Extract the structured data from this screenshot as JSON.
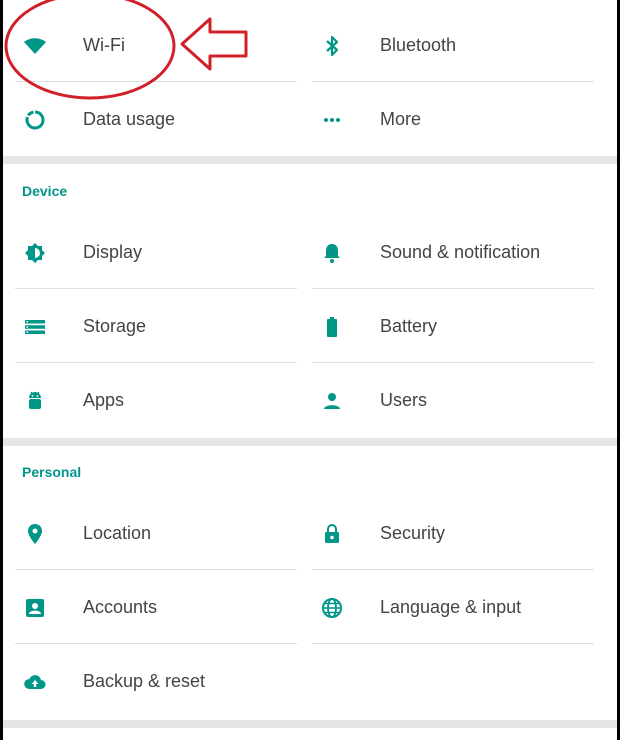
{
  "colors": {
    "accent": "#009688",
    "annotation": "#d0202a"
  },
  "top": [
    {
      "label": "Wi-Fi",
      "icon": "wifi-icon"
    },
    {
      "label": "Bluetooth",
      "icon": "bluetooth-icon"
    },
    {
      "label": "Data usage",
      "icon": "data-usage-icon"
    },
    {
      "label": "More",
      "icon": "more-dots-icon"
    }
  ],
  "device": {
    "title": "Device",
    "items": [
      {
        "label": "Display",
        "icon": "display-brightness-icon"
      },
      {
        "label": "Sound & notification",
        "icon": "bell-icon"
      },
      {
        "label": "Storage",
        "icon": "storage-icon"
      },
      {
        "label": "Battery",
        "icon": "battery-icon"
      },
      {
        "label": "Apps",
        "icon": "android-icon"
      },
      {
        "label": "Users",
        "icon": "person-icon"
      }
    ]
  },
  "personal": {
    "title": "Personal",
    "items": [
      {
        "label": "Location",
        "icon": "location-pin-icon"
      },
      {
        "label": "Security",
        "icon": "lock-icon"
      },
      {
        "label": "Accounts",
        "icon": "account-box-icon"
      },
      {
        "label": "Language & input",
        "icon": "globe-icon"
      },
      {
        "label": "Backup & reset",
        "icon": "cloud-upload-icon"
      }
    ]
  }
}
